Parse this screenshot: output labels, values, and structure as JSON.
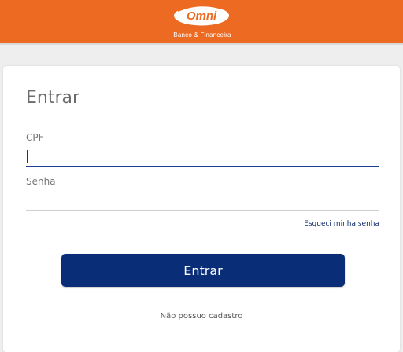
{
  "brand": {
    "name": "Omni",
    "subtitle": "Banco & Financeira",
    "header_color": "#ec6a22",
    "primary_color": "#0a2d78"
  },
  "login": {
    "title": "Entrar",
    "cpf_label": "CPF",
    "cpf_value": "",
    "senha_label": "Senha",
    "senha_value": "",
    "forgot_link": "Esqueci minha senha",
    "submit_label": "Entrar",
    "register_link": "Não possuo cadastro"
  }
}
